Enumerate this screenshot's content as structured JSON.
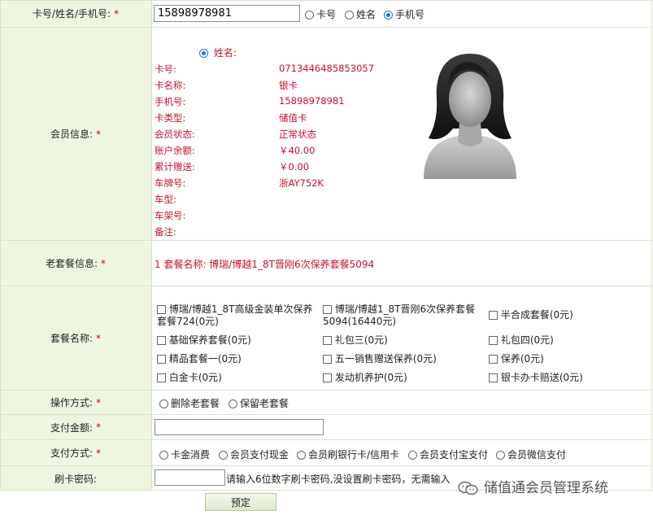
{
  "search": {
    "label": "卡号/姓名/手机号:",
    "value": "15898978981",
    "options": [
      {
        "label": "卡号",
        "selected": false
      },
      {
        "label": "姓名",
        "selected": false
      },
      {
        "label": "手机号",
        "selected": true
      }
    ]
  },
  "member": {
    "label": "会员信息:",
    "radio_label": "姓名:",
    "fields": [
      {
        "key": "卡号:",
        "value": "0713446485853057"
      },
      {
        "key": "卡名称:",
        "value": "银卡"
      },
      {
        "key": "手机号:",
        "value": "15898978981"
      },
      {
        "key": "卡类型:",
        "value": "储值卡"
      },
      {
        "key": "会员状态:",
        "value": "正常状态"
      },
      {
        "key": "账户余额:",
        "value": "￥40.00"
      },
      {
        "key": "累计赠送:",
        "value": "￥0.00"
      },
      {
        "key": "车牌号:",
        "value": "浙AY752K"
      },
      {
        "key": "车型:",
        "value": ""
      },
      {
        "key": "车架号:",
        "value": ""
      },
      {
        "key": "备注:",
        "value": ""
      }
    ],
    "avatar_icon": "female-avatar-icon"
  },
  "old_package": {
    "label": "老套餐信息:",
    "text": "1 套餐名称:   博瑞/博越1_8T晋刚6次保养套餐5094"
  },
  "packages": {
    "label": "套餐名称:",
    "items": [
      {
        "line1": "博瑞/博越1_8T高级金装单次保养",
        "line2": "套餐724(0元)"
      },
      {
        "line1": "博瑞/博越1_8T晋刚6次保养套餐",
        "line2": "5094(16440元)"
      },
      {
        "line1": "半合成套餐(0元)",
        "line2": ""
      },
      {
        "line1": "基础保养套餐(0元)",
        "line2": ""
      },
      {
        "line1": "礼包三(0元)",
        "line2": ""
      },
      {
        "line1": "礼包四(0元)",
        "line2": ""
      },
      {
        "line1": "精品套餐一(0元)",
        "line2": ""
      },
      {
        "line1": "五一销售赠送保养(0元)",
        "line2": ""
      },
      {
        "line1": "保养(0元)",
        "line2": ""
      },
      {
        "line1": "白金卡(0元)",
        "line2": ""
      },
      {
        "line1": "发动机养护(0元)",
        "line2": ""
      },
      {
        "line1": "银卡办卡赔送(0元)",
        "line2": ""
      }
    ]
  },
  "operation": {
    "label": "操作方式:",
    "options": [
      {
        "label": "删除老套餐",
        "selected": false
      },
      {
        "label": "保留老套餐",
        "selected": false
      }
    ]
  },
  "amount": {
    "label": "支付金额:",
    "value": ""
  },
  "payment": {
    "label": "支付方式:",
    "options": [
      {
        "label": "卡金消费",
        "selected": false
      },
      {
        "label": "会员支付现金",
        "selected": false
      },
      {
        "label": "会员刷银行卡/信用卡",
        "selected": false
      },
      {
        "label": "会员支付宝支付",
        "selected": false
      },
      {
        "label": "会员微信支付",
        "selected": false
      }
    ]
  },
  "password": {
    "label": "刷卡密码:",
    "value": "",
    "hint": "请输入6位数字刷卡密码,没设置刷卡密码，无需输入"
  },
  "submit_label": "预定",
  "required_mark": "*",
  "watermark": "储值通会员管理系统",
  "colors": {
    "label_bg": "#eef6e2",
    "border": "#d6e3c6",
    "info_red": "#c8102e",
    "required": "#d40000"
  }
}
